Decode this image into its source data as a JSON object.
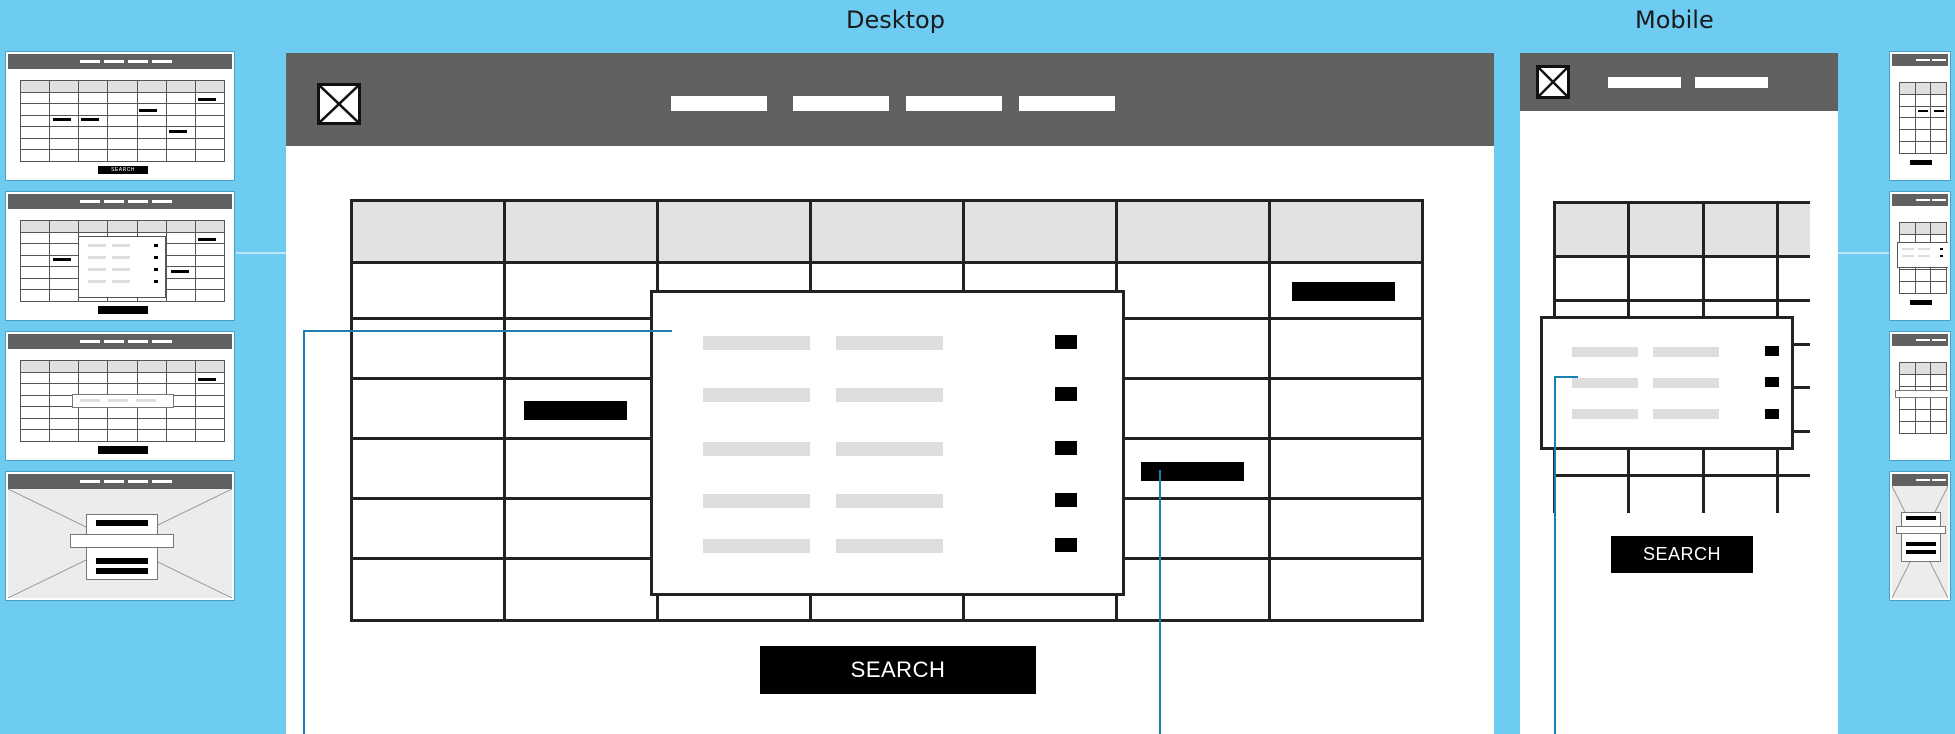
{
  "labels": {
    "desktop": "Desktop",
    "mobile": "Mobile"
  },
  "desktop": {
    "search_label": "SEARCH"
  },
  "mobile": {
    "search_label": "SEARCH"
  },
  "thumbnails": {
    "left_search": "SEARCH"
  },
  "colors": {
    "background": "#6ecbf2",
    "header": "#616161",
    "connector": "#1b7fb0",
    "button": "#000000",
    "placeholder": "#dedede"
  }
}
